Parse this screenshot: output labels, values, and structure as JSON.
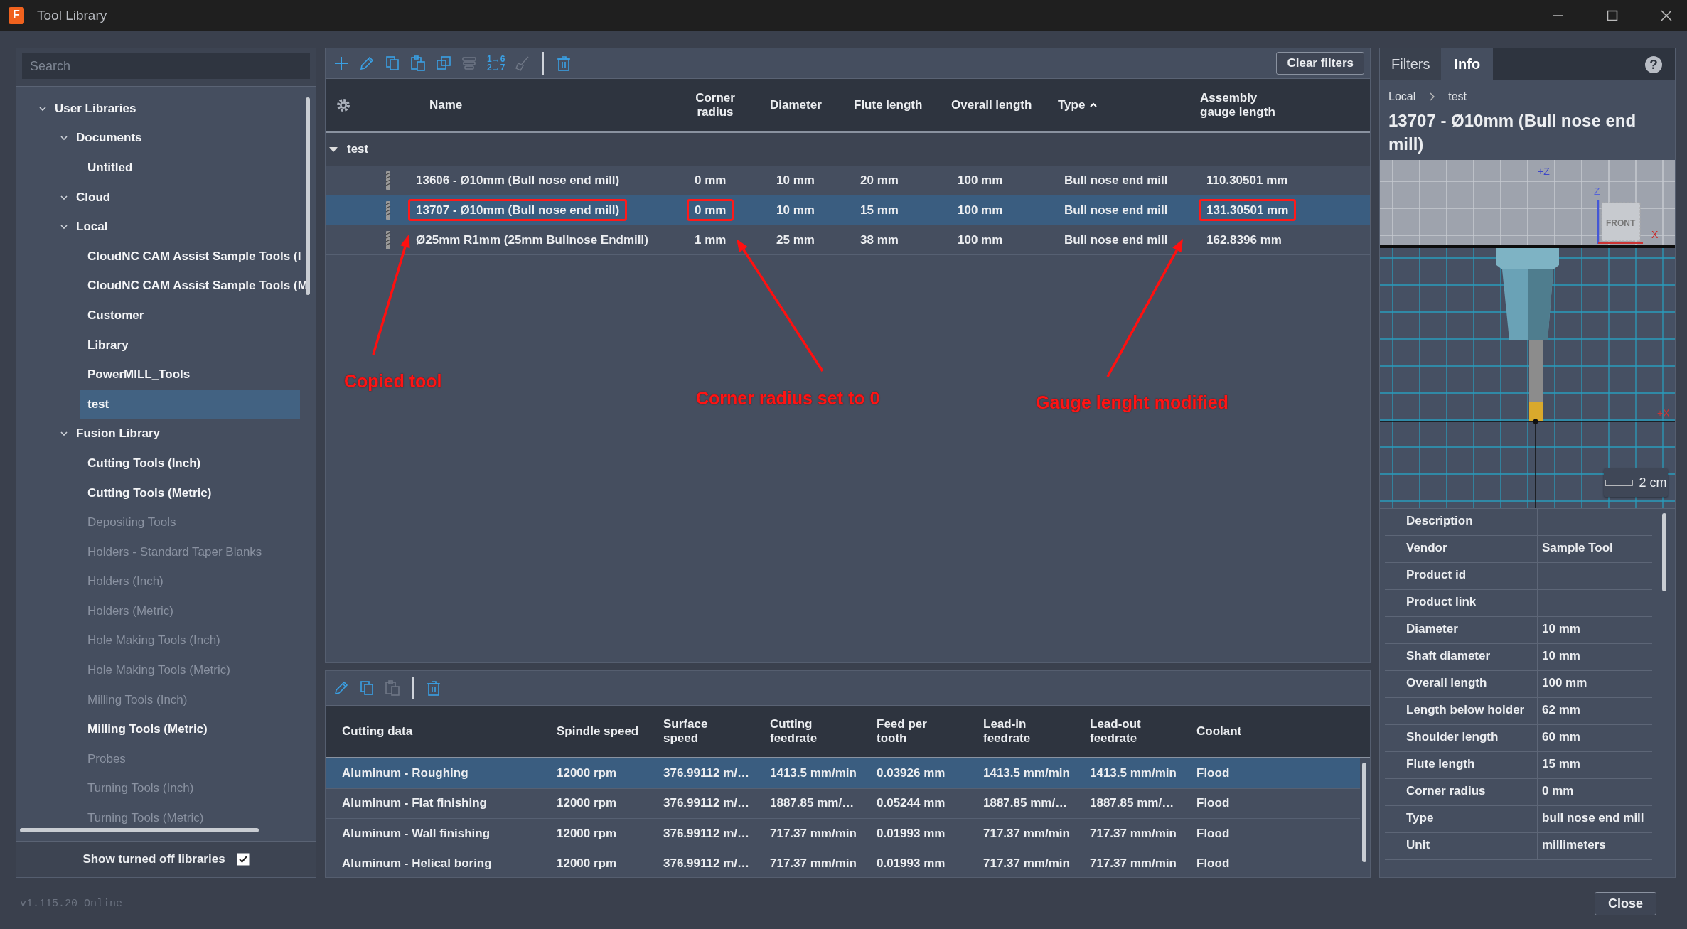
{
  "window": {
    "title": "Tool Library",
    "icon_letter": "F"
  },
  "library_panel": {
    "search": {
      "placeholder": "Search"
    },
    "tree": [
      {
        "label": "User Libraries",
        "expanded": true,
        "disabled": false,
        "selected": false,
        "children": [
          {
            "label": "Documents",
            "expanded": true,
            "disabled": false,
            "selected": false,
            "children": [
              {
                "label": "Untitled",
                "disabled": false,
                "selected": false
              }
            ]
          },
          {
            "label": "Cloud",
            "expanded": true,
            "disabled": false,
            "selected": false
          },
          {
            "label": "Local",
            "expanded": true,
            "disabled": false,
            "selected": false,
            "children": [
              {
                "label": "CloudNC CAM Assist Sample Tools (I",
                "disabled": false,
                "selected": false
              },
              {
                "label": "CloudNC CAM Assist Sample Tools (M",
                "disabled": false,
                "selected": false
              },
              {
                "label": "Customer",
                "disabled": false,
                "selected": false
              },
              {
                "label": "Library",
                "disabled": false,
                "selected": false
              },
              {
                "label": "PowerMILL_Tools",
                "disabled": false,
                "selected": false
              },
              {
                "label": "test",
                "disabled": false,
                "selected": true
              }
            ]
          },
          {
            "label": "Fusion Library",
            "expanded": true,
            "disabled": false,
            "selected": false,
            "children": [
              {
                "label": "Cutting Tools (Inch)",
                "disabled": false,
                "selected": false
              },
              {
                "label": "Cutting Tools (Metric)",
                "disabled": false,
                "selected": false
              },
              {
                "label": "Depositing Tools",
                "disabled": true,
                "selected": false
              },
              {
                "label": "Holders - Standard Taper Blanks",
                "disabled": true,
                "selected": false
              },
              {
                "label": "Holders (Inch)",
                "disabled": true,
                "selected": false
              },
              {
                "label": "Holders (Metric)",
                "disabled": true,
                "selected": false
              },
              {
                "label": "Hole Making Tools (Inch)",
                "disabled": true,
                "selected": false
              },
              {
                "label": "Hole Making Tools (Metric)",
                "disabled": true,
                "selected": false
              },
              {
                "label": "Milling Tools (Inch)",
                "disabled": true,
                "selected": false
              },
              {
                "label": "Milling Tools (Metric)",
                "disabled": false,
                "selected": false
              },
              {
                "label": "Probes",
                "disabled": true,
                "selected": false
              },
              {
                "label": "Turning Tools (Inch)",
                "disabled": true,
                "selected": false
              },
              {
                "label": "Turning Tools (Metric)",
                "disabled": true,
                "selected": false
              }
            ]
          }
        ]
      }
    ],
    "show_turned_off": {
      "label": "Show turned off libraries",
      "checked": true
    },
    "version": "v1.115.20 Online"
  },
  "tool_toolbar": [
    {
      "kind": "add",
      "disabled": false
    },
    {
      "kind": "edit",
      "disabled": false
    },
    {
      "kind": "copy",
      "disabled": false
    },
    {
      "kind": "paste",
      "disabled": false
    },
    {
      "kind": "duplicate",
      "disabled": false
    },
    {
      "kind": "stack",
      "disabled": true
    },
    {
      "kind": "renumber",
      "disabled": false,
      "text": [
        "1→6",
        "2→7"
      ]
    },
    {
      "kind": "clean",
      "disabled": true
    },
    {
      "kind": "separator"
    },
    {
      "kind": "delete",
      "disabled": false
    }
  ],
  "clear_filters": "Clear filters",
  "tool_table": {
    "columns": [
      {
        "label": "Name",
        "sorted": false
      },
      {
        "label": "Corner radius",
        "sorted": false
      },
      {
        "label": "Diameter",
        "sorted": false
      },
      {
        "label": "Flute length",
        "sorted": false
      },
      {
        "label": "Overall length",
        "sorted": false
      },
      {
        "label": "Type",
        "sorted": true
      },
      {
        "label": "Assembly gauge length",
        "sorted": false
      }
    ],
    "group": {
      "label": "test",
      "expanded": true
    },
    "rows": [
      {
        "cells": [
          "13606 - Ø10mm (Bull nose end mill)",
          "0 mm",
          "10 mm",
          "20 mm",
          "100 mm",
          "Bull nose end mill",
          "110.30501 mm"
        ],
        "boxed": [
          false,
          false,
          false,
          false,
          false,
          false,
          false
        ],
        "selected": false
      },
      {
        "cells": [
          "13707 - Ø10mm (Bull nose end mill)",
          "0 mm",
          "10 mm",
          "15 mm",
          "100 mm",
          "Bull nose end mill",
          "131.30501 mm"
        ],
        "boxed": [
          true,
          true,
          false,
          false,
          false,
          false,
          true
        ],
        "selected": true
      },
      {
        "cells": [
          "Ø25mm R1mm (25mm Bullnose Endmill)",
          "1 mm",
          "25 mm",
          "38 mm",
          "100 mm",
          "Bull nose end mill",
          "162.8396 mm"
        ],
        "boxed": [
          false,
          false,
          false,
          false,
          false,
          false,
          false
        ],
        "selected": false
      }
    ]
  },
  "annotations": [
    {
      "text": "Copied tool"
    },
    {
      "text": "Corner radius set to 0"
    },
    {
      "text": "Gauge lenght modified"
    }
  ],
  "cutting_toolbar": [
    {
      "kind": "edit",
      "disabled": false
    },
    {
      "kind": "copy",
      "disabled": false
    },
    {
      "kind": "paste",
      "disabled": true
    },
    {
      "kind": "separator"
    },
    {
      "kind": "delete",
      "disabled": false
    }
  ],
  "cutting_table": {
    "columns": [
      "Cutting data",
      "Spindle speed",
      "Surface speed",
      "Cutting feedrate",
      "Feed per tooth",
      "Lead-in feedrate",
      "Lead-out feedrate",
      "Coolant"
    ],
    "rows": [
      {
        "cells": [
          "Aluminum - Roughing",
          "12000 rpm",
          "376.99112 m/…",
          "1413.5 mm/min",
          "0.03926 mm",
          "1413.5 mm/min",
          "1413.5 mm/min",
          "Flood"
        ],
        "selected": true
      },
      {
        "cells": [
          "Aluminum - Flat finishing",
          "12000 rpm",
          "376.99112 m/…",
          "1887.85 mm/…",
          "0.05244 mm",
          "1887.85 mm/…",
          "1887.85 mm/…",
          "Flood"
        ],
        "selected": false
      },
      {
        "cells": [
          "Aluminum - Wall finishing",
          "12000 rpm",
          "376.99112 m/…",
          "717.37 mm/min",
          "0.01993 mm",
          "717.37 mm/min",
          "717.37 mm/min",
          "Flood"
        ],
        "selected": false
      },
      {
        "cells": [
          "Aluminum - Helical boring",
          "12000 rpm",
          "376.99112 m/…",
          "717.37 mm/min",
          "0.01993 mm",
          "717.37 mm/min",
          "717.37 mm/min",
          "Flood"
        ],
        "selected": false
      }
    ]
  },
  "info_panel": {
    "tabs": [
      {
        "label": "Filters",
        "selected": false
      },
      {
        "label": "Info",
        "selected": true
      }
    ],
    "help": "?",
    "breadcrumb": [
      "Local",
      "test"
    ],
    "title": "13707 - Ø10mm (Bull nose end mill)",
    "preview": {
      "top_axis": "+Z",
      "cube_axis_z": "Z",
      "cube_face": "FRONT",
      "cube_axis_x": "X",
      "side_axis": "+X",
      "scale": "2 cm"
    },
    "properties": [
      {
        "label": "Description"
      },
      {
        "label": "Vendor",
        "value": "Sample Tool"
      },
      {
        "label": "Product id"
      },
      {
        "label": "Product link"
      },
      {
        "label": "Diameter",
        "value": "10 mm"
      },
      {
        "label": "Shaft diameter",
        "value": "10 mm"
      },
      {
        "label": "Overall length",
        "value": "100 mm"
      },
      {
        "label": "Length below holder",
        "value": "62 mm"
      },
      {
        "label": "Shoulder length",
        "value": "60 mm"
      },
      {
        "label": "Flute length",
        "value": "15 mm"
      },
      {
        "label": "Corner radius",
        "value": "0 mm"
      },
      {
        "label": "Type",
        "value": "bull nose end mill"
      },
      {
        "label": "Unit",
        "value": "millimeters"
      }
    ]
  },
  "close_button": "Close"
}
